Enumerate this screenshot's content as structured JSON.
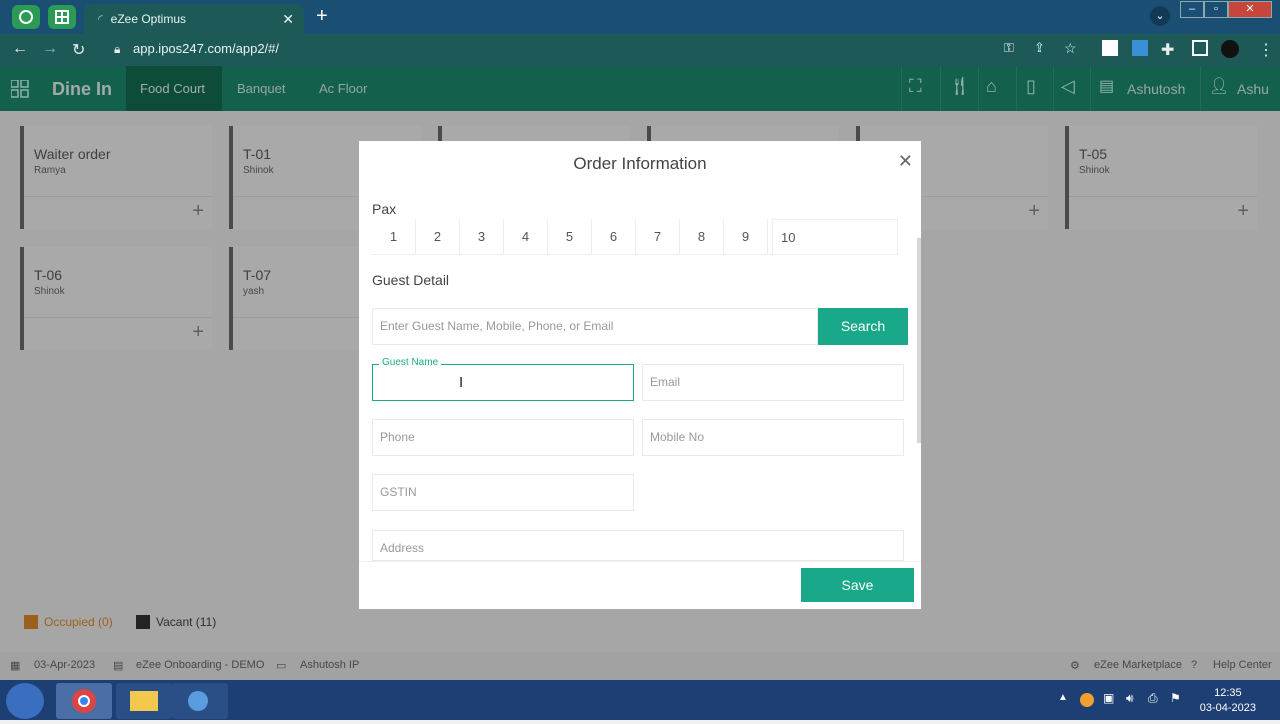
{
  "browser": {
    "tab_title": "eZee Optimus",
    "url": "app.ipos247.com/app2/#/"
  },
  "header": {
    "title": "Dine In",
    "tabs": [
      "Food Court",
      "Banquet",
      "Ac Floor"
    ],
    "user1": "Ashutosh",
    "user2": "Ashu"
  },
  "tables": [
    {
      "name": "Waiter order",
      "sub": "Ramya"
    },
    {
      "name": "T-01",
      "sub": "Shinok"
    },
    {
      "name": "T-05",
      "sub": "Shinok"
    },
    {
      "name": "T-06",
      "sub": "Shinok"
    },
    {
      "name": "T-07",
      "sub": "yash"
    }
  ],
  "legend": {
    "occupied": "Occupied (0)",
    "vacant": "Vacant (11)"
  },
  "footer": {
    "date": "03-Apr-2023",
    "property": "eZee Onboarding - DEMO",
    "terminal": "Ashutosh IP",
    "marketplace": "eZee Marketplace",
    "help": "Help Center"
  },
  "modal": {
    "title": "Order Information",
    "pax_label": "Pax",
    "pax_options": [
      "1",
      "2",
      "3",
      "4",
      "5",
      "6",
      "7",
      "8",
      "9",
      "10"
    ],
    "guest_detail_label": "Guest Detail",
    "search_placeholder": "Enter Guest Name, Mobile, Phone, or Email",
    "search_button": "Search",
    "guest_name_label": "Guest Name",
    "email_placeholder": "Email",
    "phone_placeholder": "Phone",
    "mobile_placeholder": "Mobile No",
    "gstin_placeholder": "GSTIN",
    "address_placeholder": "Address",
    "save_button": "Save",
    "close": "✕"
  },
  "taskbar": {
    "time": "12:35",
    "date": "03-04-2023"
  },
  "colors": {
    "accent": "#19a88a",
    "header": "#1c8c6e",
    "occupied": "#e08a2a",
    "vacant": "#333333"
  }
}
